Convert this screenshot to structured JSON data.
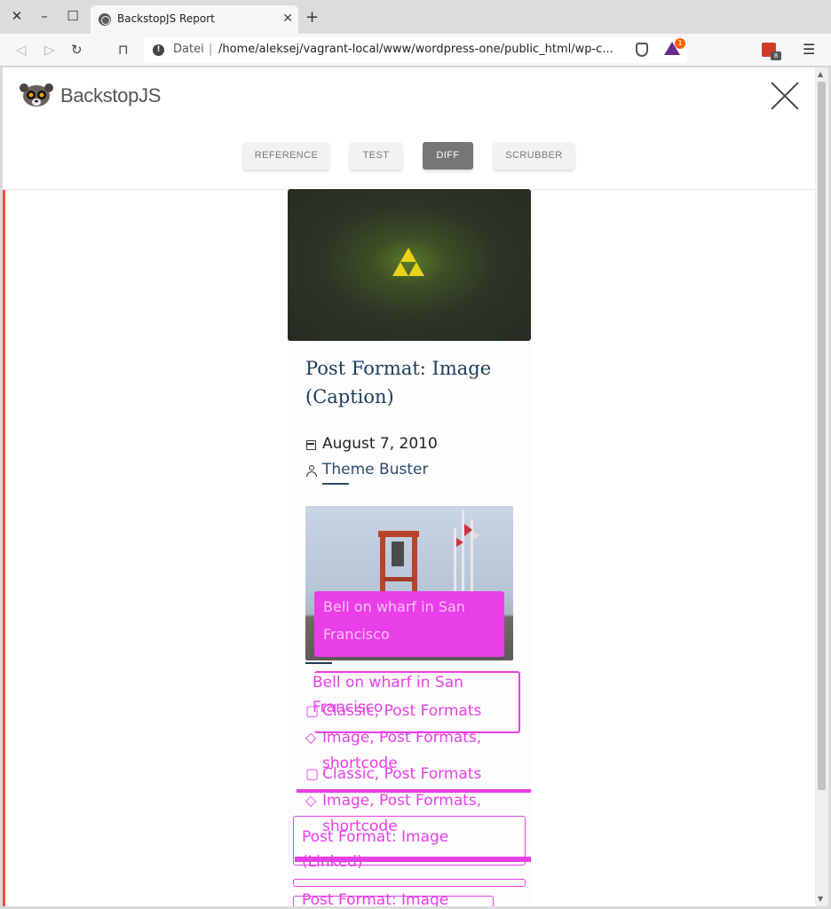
{
  "browser": {
    "tab_title": "BackstopJS Report",
    "url_security_label": "Datei",
    "url": "/home/aleksej/vagrant-local/www/wordpress-one/public_html/wp-c...",
    "bat_badge": "1",
    "ext_badge": "8"
  },
  "app": {
    "brand": "BackstopJS",
    "view_buttons": [
      "REFERENCE",
      "TEST",
      "DIFF",
      "SCRUBBER"
    ],
    "active_view": "DIFF"
  },
  "diff_image": {
    "post_title": "Post Format: Image (Caption)",
    "date": "August 7, 2010",
    "author": "Theme Buster",
    "caption_1": "Bell on wharf in San",
    "caption_2": "Francisco",
    "categories_1": "Classic, Post Formats",
    "tags_1a": "Image, Post Formats,",
    "tags_1b": "shortcode",
    "categories_2": "Classic, Post Formats",
    "tags_2a": "Image, Post Formats,",
    "tags_2b": "shortcode",
    "next_title_1a": "Post Format: Image",
    "next_title_1b": "(Linked)",
    "next_title_2": "Post Format: Image",
    "ghost_caption_1": "Bell on wharf in San",
    "ghost_caption_2": "Francisco",
    "diff_color": "#e93ee8"
  }
}
